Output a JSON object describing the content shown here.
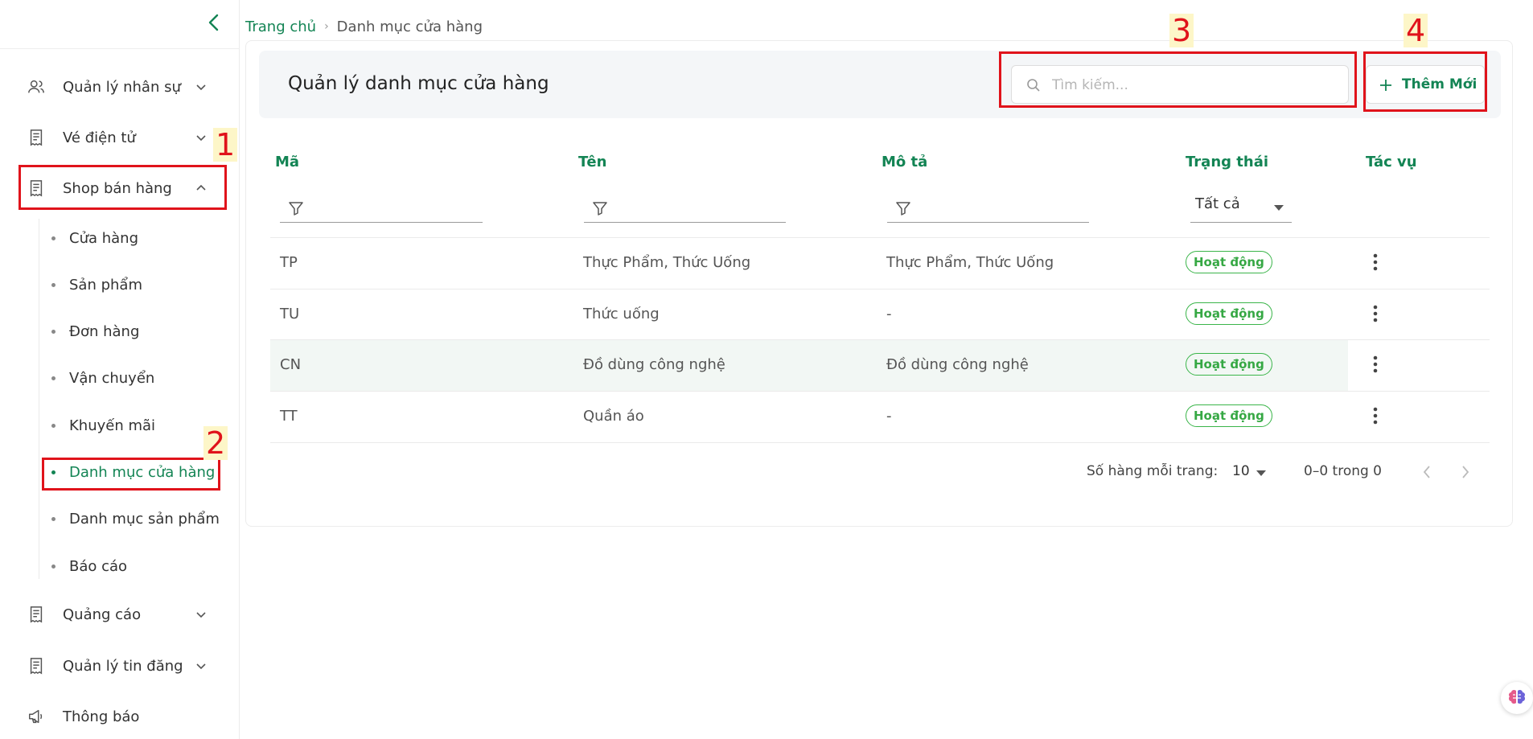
{
  "sidebar": {
    "items": [
      {
        "label": "Quản lý nhân sự",
        "icon": "users-icon",
        "expanded": false
      },
      {
        "label": "Vé điện tử",
        "icon": "receipt-icon",
        "expanded": false
      },
      {
        "label": "Shop bán hàng",
        "icon": "receipt-icon",
        "expanded": true
      },
      {
        "label": "Quảng cáo",
        "icon": "receipt-icon",
        "expanded": false
      },
      {
        "label": "Quản lý tin đăng",
        "icon": "receipt-icon",
        "expanded": false
      },
      {
        "label": "Thông báo",
        "icon": "megaphone-icon"
      }
    ],
    "shop_sub_items": [
      {
        "label": "Cửa hàng",
        "active": false
      },
      {
        "label": "Sản phẩm",
        "active": false
      },
      {
        "label": "Đơn hàng",
        "active": false
      },
      {
        "label": "Vận chuyển",
        "active": false
      },
      {
        "label": "Khuyến mãi",
        "active": false
      },
      {
        "label": "Danh mục cửa hàng",
        "active": true
      },
      {
        "label": "Danh mục sản phẩm",
        "active": false
      },
      {
        "label": "Báo cáo",
        "active": false
      }
    ]
  },
  "breadcrumb": {
    "home": "Trang chủ",
    "separator": "›",
    "current": "Danh mục cửa hàng"
  },
  "header": {
    "title": "Quản lý danh mục cửa hàng",
    "search_placeholder": "Tìm kiếm...",
    "add_label": "Thêm Mới"
  },
  "table": {
    "columns": [
      "Mã",
      "Tên",
      "Mô tả",
      "Trạng thái",
      "Tác vụ"
    ],
    "status_filter": "Tất cả",
    "rows": [
      {
        "code": "TP",
        "name": "Thực Phẩm, Thức Uống",
        "description": "Thực Phẩm, Thức Uống",
        "status": "Hoạt động"
      },
      {
        "code": "TU",
        "name": "Thức uống",
        "description": "-",
        "status": "Hoạt động"
      },
      {
        "code": "CN",
        "name": "Đồ dùng công nghệ",
        "description": "Đồ dùng công nghệ",
        "status": "Hoạt động"
      },
      {
        "code": "TT",
        "name": "Quần áo",
        "description": "-",
        "status": "Hoạt động"
      }
    ]
  },
  "pagination": {
    "rows_per_page_label": "Số hàng mỗi trang:",
    "rows_per_page": "10",
    "range": "0–0 trong 0"
  },
  "annotations": [
    "1",
    "2",
    "3",
    "4"
  ],
  "colors": {
    "brand_green": "#138454",
    "status_green": "#36a844",
    "annotation_red": "#e0131b"
  }
}
